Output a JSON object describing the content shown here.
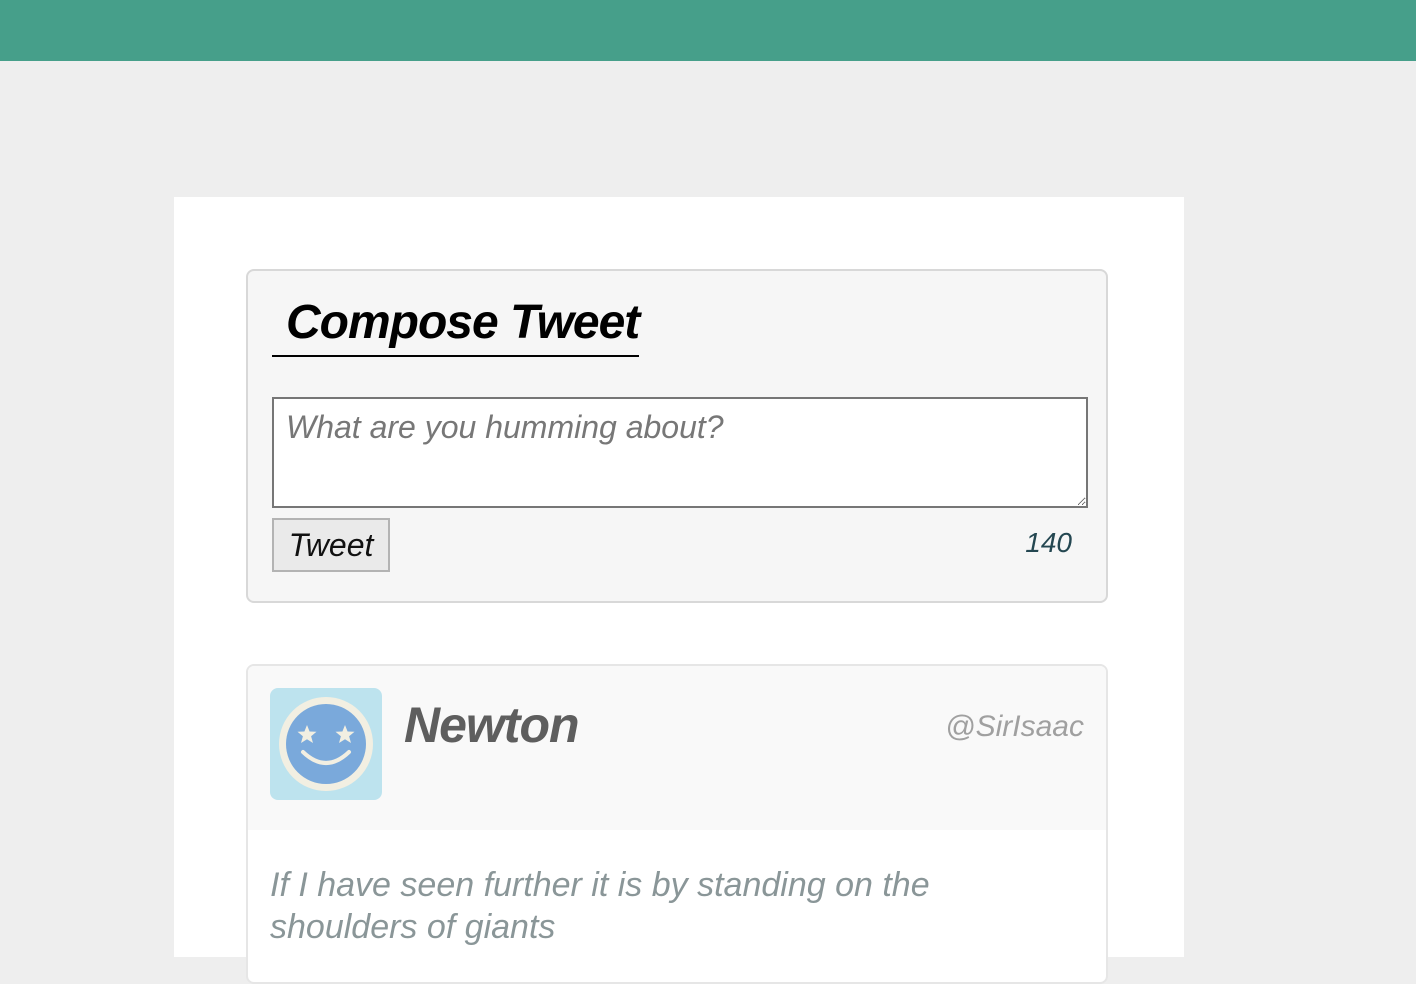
{
  "compose": {
    "title": "Compose Tweet",
    "placeholder": "What are you humming about?",
    "button_label": "Tweet",
    "char_count": "140"
  },
  "tweets": [
    {
      "name": "Newton",
      "handle": "@SirIsaac",
      "avatar_icon": "smiley-star-eyes-icon",
      "text": "If I have seen further it is by standing on the shoulders of giants"
    }
  ],
  "colors": {
    "topbar": "#469f8a",
    "background": "#eeeeee",
    "avatar_bg": "#bde3ee",
    "avatar_face": "#7aa9db"
  }
}
